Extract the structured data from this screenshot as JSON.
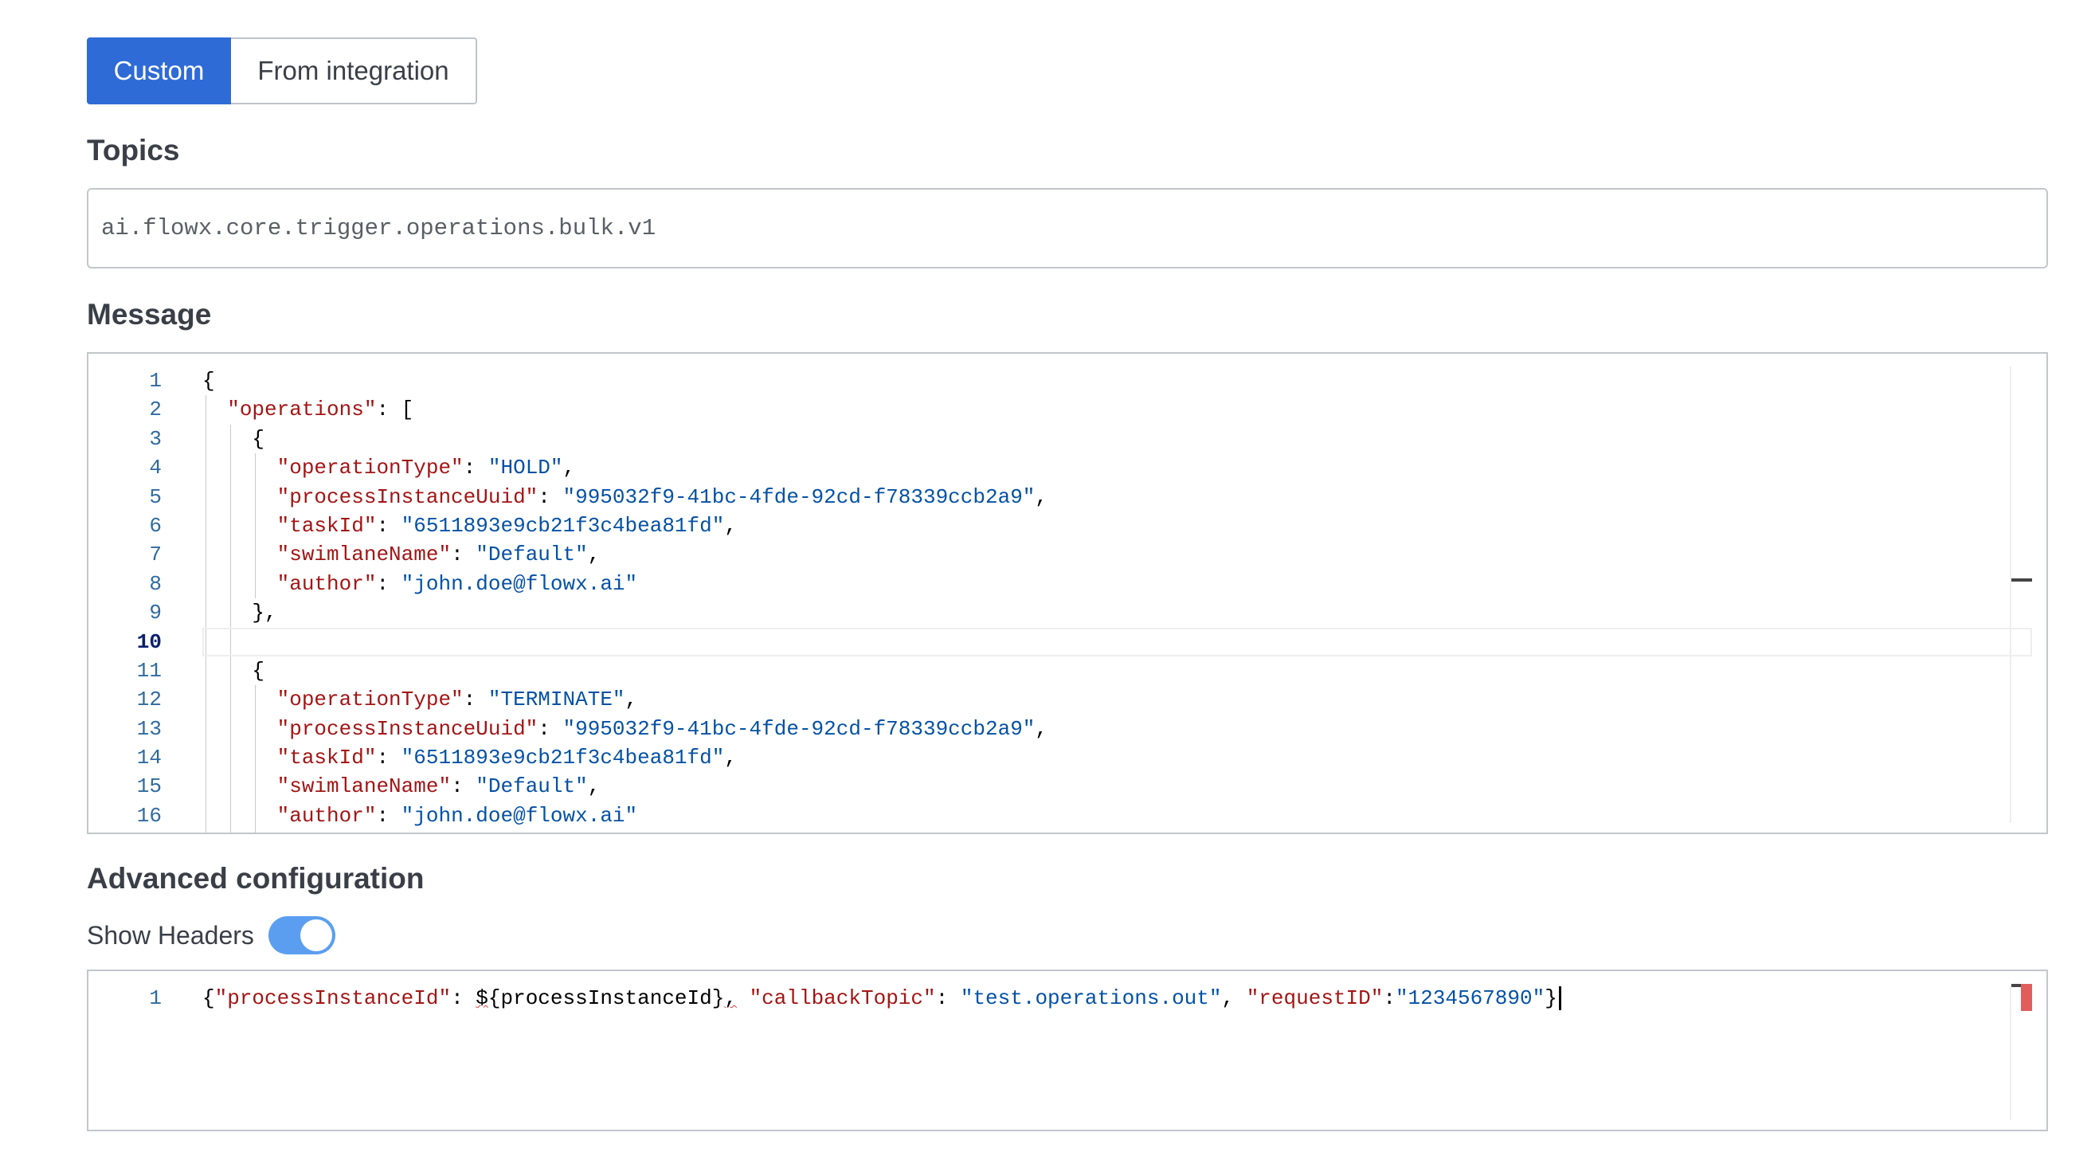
{
  "source_toggle": {
    "options": [
      "Custom",
      "From integration"
    ],
    "selected": "Custom"
  },
  "topics": {
    "label": "Topics",
    "value": "ai.flowx.core.trigger.operations.bulk.v1"
  },
  "message": {
    "label": "Message",
    "current_line": 10,
    "lines": [
      {
        "n": "1",
        "indent": 0,
        "tokens": [
          [
            "p",
            "{"
          ]
        ]
      },
      {
        "n": "2",
        "indent": 1,
        "tokens": [
          [
            "k",
            "\"operations\""
          ],
          [
            "p",
            ": ["
          ]
        ]
      },
      {
        "n": "3",
        "indent": 2,
        "tokens": [
          [
            "p",
            "{"
          ]
        ]
      },
      {
        "n": "4",
        "indent": 3,
        "tokens": [
          [
            "k",
            "\"operationType\""
          ],
          [
            "p",
            ": "
          ],
          [
            "s",
            "\"HOLD\""
          ],
          [
            "p",
            ","
          ]
        ]
      },
      {
        "n": "5",
        "indent": 3,
        "tokens": [
          [
            "k",
            "\"processInstanceUuid\""
          ],
          [
            "p",
            ": "
          ],
          [
            "s",
            "\"995032f9-41bc-4fde-92cd-f78339ccb2a9\""
          ],
          [
            "p",
            ","
          ]
        ]
      },
      {
        "n": "6",
        "indent": 3,
        "tokens": [
          [
            "k",
            "\"taskId\""
          ],
          [
            "p",
            ": "
          ],
          [
            "s",
            "\"6511893e9cb21f3c4bea81fd\""
          ],
          [
            "p",
            ","
          ]
        ]
      },
      {
        "n": "7",
        "indent": 3,
        "tokens": [
          [
            "k",
            "\"swimlaneName\""
          ],
          [
            "p",
            ": "
          ],
          [
            "s",
            "\"Default\""
          ],
          [
            "p",
            ","
          ]
        ]
      },
      {
        "n": "8",
        "indent": 3,
        "tokens": [
          [
            "k",
            "\"author\""
          ],
          [
            "p",
            ": "
          ],
          [
            "s",
            "\"john.doe@flowx.ai\""
          ]
        ]
      },
      {
        "n": "9",
        "indent": 2,
        "tokens": [
          [
            "p",
            "},"
          ]
        ]
      },
      {
        "n": "10",
        "indent": 0,
        "tokens": []
      },
      {
        "n": "11",
        "indent": 2,
        "tokens": [
          [
            "p",
            "{"
          ]
        ]
      },
      {
        "n": "12",
        "indent": 3,
        "tokens": [
          [
            "k",
            "\"operationType\""
          ],
          [
            "p",
            ": "
          ],
          [
            "s",
            "\"TERMINATE\""
          ],
          [
            "p",
            ","
          ]
        ]
      },
      {
        "n": "13",
        "indent": 3,
        "tokens": [
          [
            "k",
            "\"processInstanceUuid\""
          ],
          [
            "p",
            ": "
          ],
          [
            "s",
            "\"995032f9-41bc-4fde-92cd-f78339ccb2a9\""
          ],
          [
            "p",
            ","
          ]
        ]
      },
      {
        "n": "14",
        "indent": 3,
        "tokens": [
          [
            "k",
            "\"taskId\""
          ],
          [
            "p",
            ": "
          ],
          [
            "s",
            "\"6511893e9cb21f3c4bea81fd\""
          ],
          [
            "p",
            ","
          ]
        ]
      },
      {
        "n": "15",
        "indent": 3,
        "tokens": [
          [
            "k",
            "\"swimlaneName\""
          ],
          [
            "p",
            ": "
          ],
          [
            "s",
            "\"Default\""
          ],
          [
            "p",
            ","
          ]
        ]
      },
      {
        "n": "16",
        "indent": 3,
        "tokens": [
          [
            "k",
            "\"author\""
          ],
          [
            "p",
            ": "
          ],
          [
            "s",
            "\"john.doe@flowx.ai\""
          ]
        ]
      }
    ]
  },
  "advanced": {
    "label": "Advanced configuration",
    "show_headers_label": "Show Headers",
    "show_headers_on": true,
    "headers_lines": [
      {
        "n": "1",
        "indent": 0,
        "tokens": [
          [
            "p",
            "{"
          ],
          [
            "k",
            "\"processInstanceId\""
          ],
          [
            "p",
            ": "
          ],
          [
            "q",
            "$"
          ],
          [
            "p",
            "{processInstanceId}"
          ],
          [
            "q",
            ","
          ],
          [
            "p",
            " "
          ],
          [
            "k",
            "\"callbackTopic\""
          ],
          [
            "p",
            ": "
          ],
          [
            "s",
            "\"test.operations.out\""
          ],
          [
            "p",
            ", "
          ],
          [
            "k",
            "\"requestID\""
          ],
          [
            "p",
            ":"
          ],
          [
            "s",
            "\"1234567890\""
          ],
          [
            "p",
            "}"
          ]
        ]
      }
    ]
  },
  "colors": {
    "accent": "#2f6bd6",
    "json_key": "#a31515",
    "json_string": "#0451a5",
    "line_number": "#2f6b9f",
    "toggle_on": "#5b9ef0",
    "error_marker": "#e25c5c"
  }
}
